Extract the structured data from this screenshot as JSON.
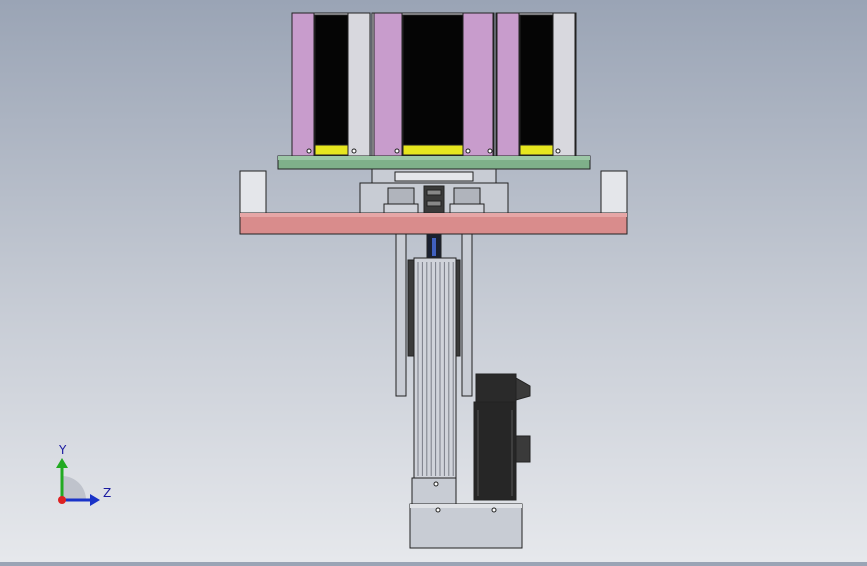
{
  "viewport": {
    "background_top": "#9aa4b5",
    "background_bottom": "#e6e8ec"
  },
  "colors": {
    "outline": "#222222",
    "side_panel": "#c89ccc",
    "light_panel": "#d8d8de",
    "dark_cavity": "#050505",
    "yellow_strip": "#e6e61e",
    "green_plate": "#7fb08a",
    "pink_base": "#d98c8c",
    "grey_part": "#c8ccd4",
    "dark_motor": "#262626",
    "light_grey": "#e4e6ea"
  },
  "triad": {
    "y_label": "Y",
    "z_label": "Z",
    "y_axis_color": "#22aa22",
    "z_axis_color": "#1a33c8",
    "origin_color": "#dd2222"
  }
}
